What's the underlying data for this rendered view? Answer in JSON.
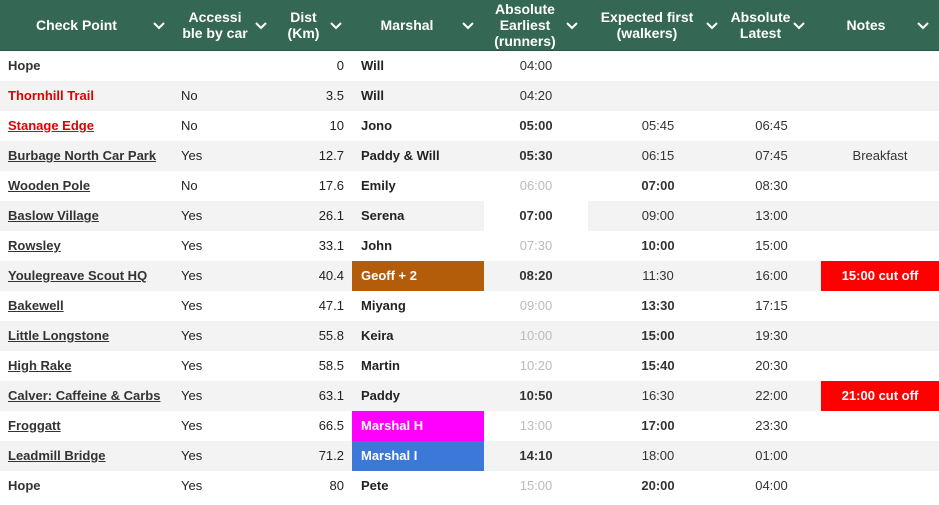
{
  "colors": {
    "header_bg": "#356854",
    "red_text": "#e00000",
    "orange_marshal": "#b35c0a",
    "magenta_marshal": "#ff00ff",
    "blue_marshal": "#3c78d8",
    "red_note": "#ff0000"
  },
  "icons": {
    "column_filter": "chevron-down-icon"
  },
  "headers": {
    "checkpoint": "Check Point",
    "accessible": "Accessi ble by car",
    "dist": "Dist (Km)",
    "marshal": "Marshal",
    "abs_earliest": "Absolute Earliest (runners)",
    "expected": "Expected first (walkers)",
    "abs_latest": "Absolute Latest",
    "notes": "Notes"
  },
  "rows": [
    {
      "checkpoint": "Hope",
      "accessible": "",
      "dist": "0",
      "marshal": "Will",
      "abs_earliest": "04:00",
      "expected": "",
      "abs_latest": "",
      "notes": ""
    },
    {
      "checkpoint": "Thornhill Trail",
      "accessible": "No",
      "dist": "3.5",
      "marshal": "Will",
      "abs_earliest": "04:20",
      "expected": "",
      "abs_latest": "",
      "notes": ""
    },
    {
      "checkpoint": "Stanage Edge",
      "accessible": "No",
      "dist": "10",
      "marshal": "Jono",
      "abs_earliest": "05:00",
      "expected": "05:45",
      "abs_latest": "06:45",
      "notes": ""
    },
    {
      "checkpoint": "Burbage North Car Park",
      "accessible": "Yes",
      "dist": "12.7",
      "marshal": "Paddy & Will",
      "abs_earliest": "05:30",
      "expected": "06:15",
      "abs_latest": "07:45",
      "notes": "Breakfast"
    },
    {
      "checkpoint": "Wooden Pole",
      "accessible": "No",
      "dist": "17.6",
      "marshal": "Emily",
      "abs_earliest": "06:00",
      "expected": "07:00",
      "abs_latest": "08:30",
      "notes": ""
    },
    {
      "checkpoint": "Baslow Village",
      "accessible": "Yes",
      "dist": "26.1",
      "marshal": "Serena",
      "abs_earliest": "07:00",
      "expected": "09:00",
      "abs_latest": "13:00",
      "notes": ""
    },
    {
      "checkpoint": "Rowsley",
      "accessible": "Yes",
      "dist": "33.1",
      "marshal": "John",
      "abs_earliest": "07:30",
      "expected": "10:00",
      "abs_latest": "15:00",
      "notes": ""
    },
    {
      "checkpoint": "Youlegreave Scout HQ",
      "accessible": "Yes",
      "dist": "40.4",
      "marshal": "Geoff + 2",
      "abs_earliest": "08:20",
      "expected": "11:30",
      "abs_latest": "16:00",
      "notes": "15:00 cut off"
    },
    {
      "checkpoint": "Bakewell",
      "accessible": "Yes",
      "dist": "47.1",
      "marshal": "Miyang",
      "abs_earliest": "09:00",
      "expected": "13:30",
      "abs_latest": "17:15",
      "notes": ""
    },
    {
      "checkpoint": "Little Longstone",
      "accessible": "Yes",
      "dist": "55.8",
      "marshal": "Keira",
      "abs_earliest": "10:00",
      "expected": "15:00",
      "abs_latest": "19:30",
      "notes": ""
    },
    {
      "checkpoint": "High Rake",
      "accessible": "Yes",
      "dist": "58.5",
      "marshal": "Martin",
      "abs_earliest": "10:20",
      "expected": "15:40",
      "abs_latest": "20:30",
      "notes": ""
    },
    {
      "checkpoint": "Calver: Caffeine & Carbs",
      "accessible": "Yes",
      "dist": "63.1",
      "marshal": "Paddy",
      "abs_earliest": "10:50",
      "expected": "16:30",
      "abs_latest": "22:00",
      "notes": "21:00 cut off"
    },
    {
      "checkpoint": "Froggatt",
      "accessible": "Yes",
      "dist": "66.5",
      "marshal": "Marshal H",
      "abs_earliest": "13:00",
      "expected": "17:00",
      "abs_latest": "23:30",
      "notes": ""
    },
    {
      "checkpoint": "Leadmill Bridge",
      "accessible": "Yes",
      "dist": "71.2",
      "marshal": "Marshal I",
      "abs_earliest": "14:10",
      "expected": "18:00",
      "abs_latest": "01:00",
      "notes": ""
    },
    {
      "checkpoint": "Hope",
      "accessible": "Yes",
      "dist": "80",
      "marshal": "Pete",
      "abs_earliest": "15:00",
      "expected": "20:00",
      "abs_latest": "04:00",
      "notes": ""
    }
  ]
}
